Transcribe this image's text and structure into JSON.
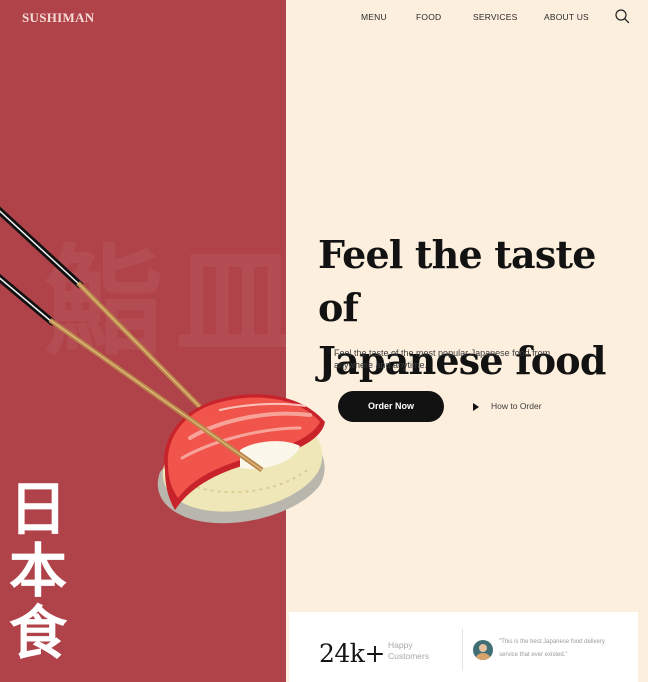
{
  "brand": {
    "logo": "SUSHIMAN"
  },
  "nav": {
    "items": [
      "MENU",
      "FOOD",
      "SERVICES",
      "ABOUT US"
    ],
    "search_icon": "search-icon"
  },
  "decor": {
    "background_kanji": "鮨皿",
    "vertical_kanji": [
      "日",
      "本",
      "食"
    ]
  },
  "hero": {
    "title_line1": "Feel the taste of",
    "title_line2": "Japanese food",
    "subtitle": "Feel the taste of the most popular Japanese food from anywhere and anytime.",
    "cta_primary": "Order Now",
    "cta_secondary": "How to Order"
  },
  "stats": {
    "number": "24k+",
    "label": "Happy Customers",
    "quote": "\"This is the best Japanese food delivery service that ever existed.\""
  },
  "colors": {
    "left_panel": "#b0434a",
    "right_panel": "#fdefde",
    "button": "#121212",
    "salmon": "#f04a40"
  }
}
